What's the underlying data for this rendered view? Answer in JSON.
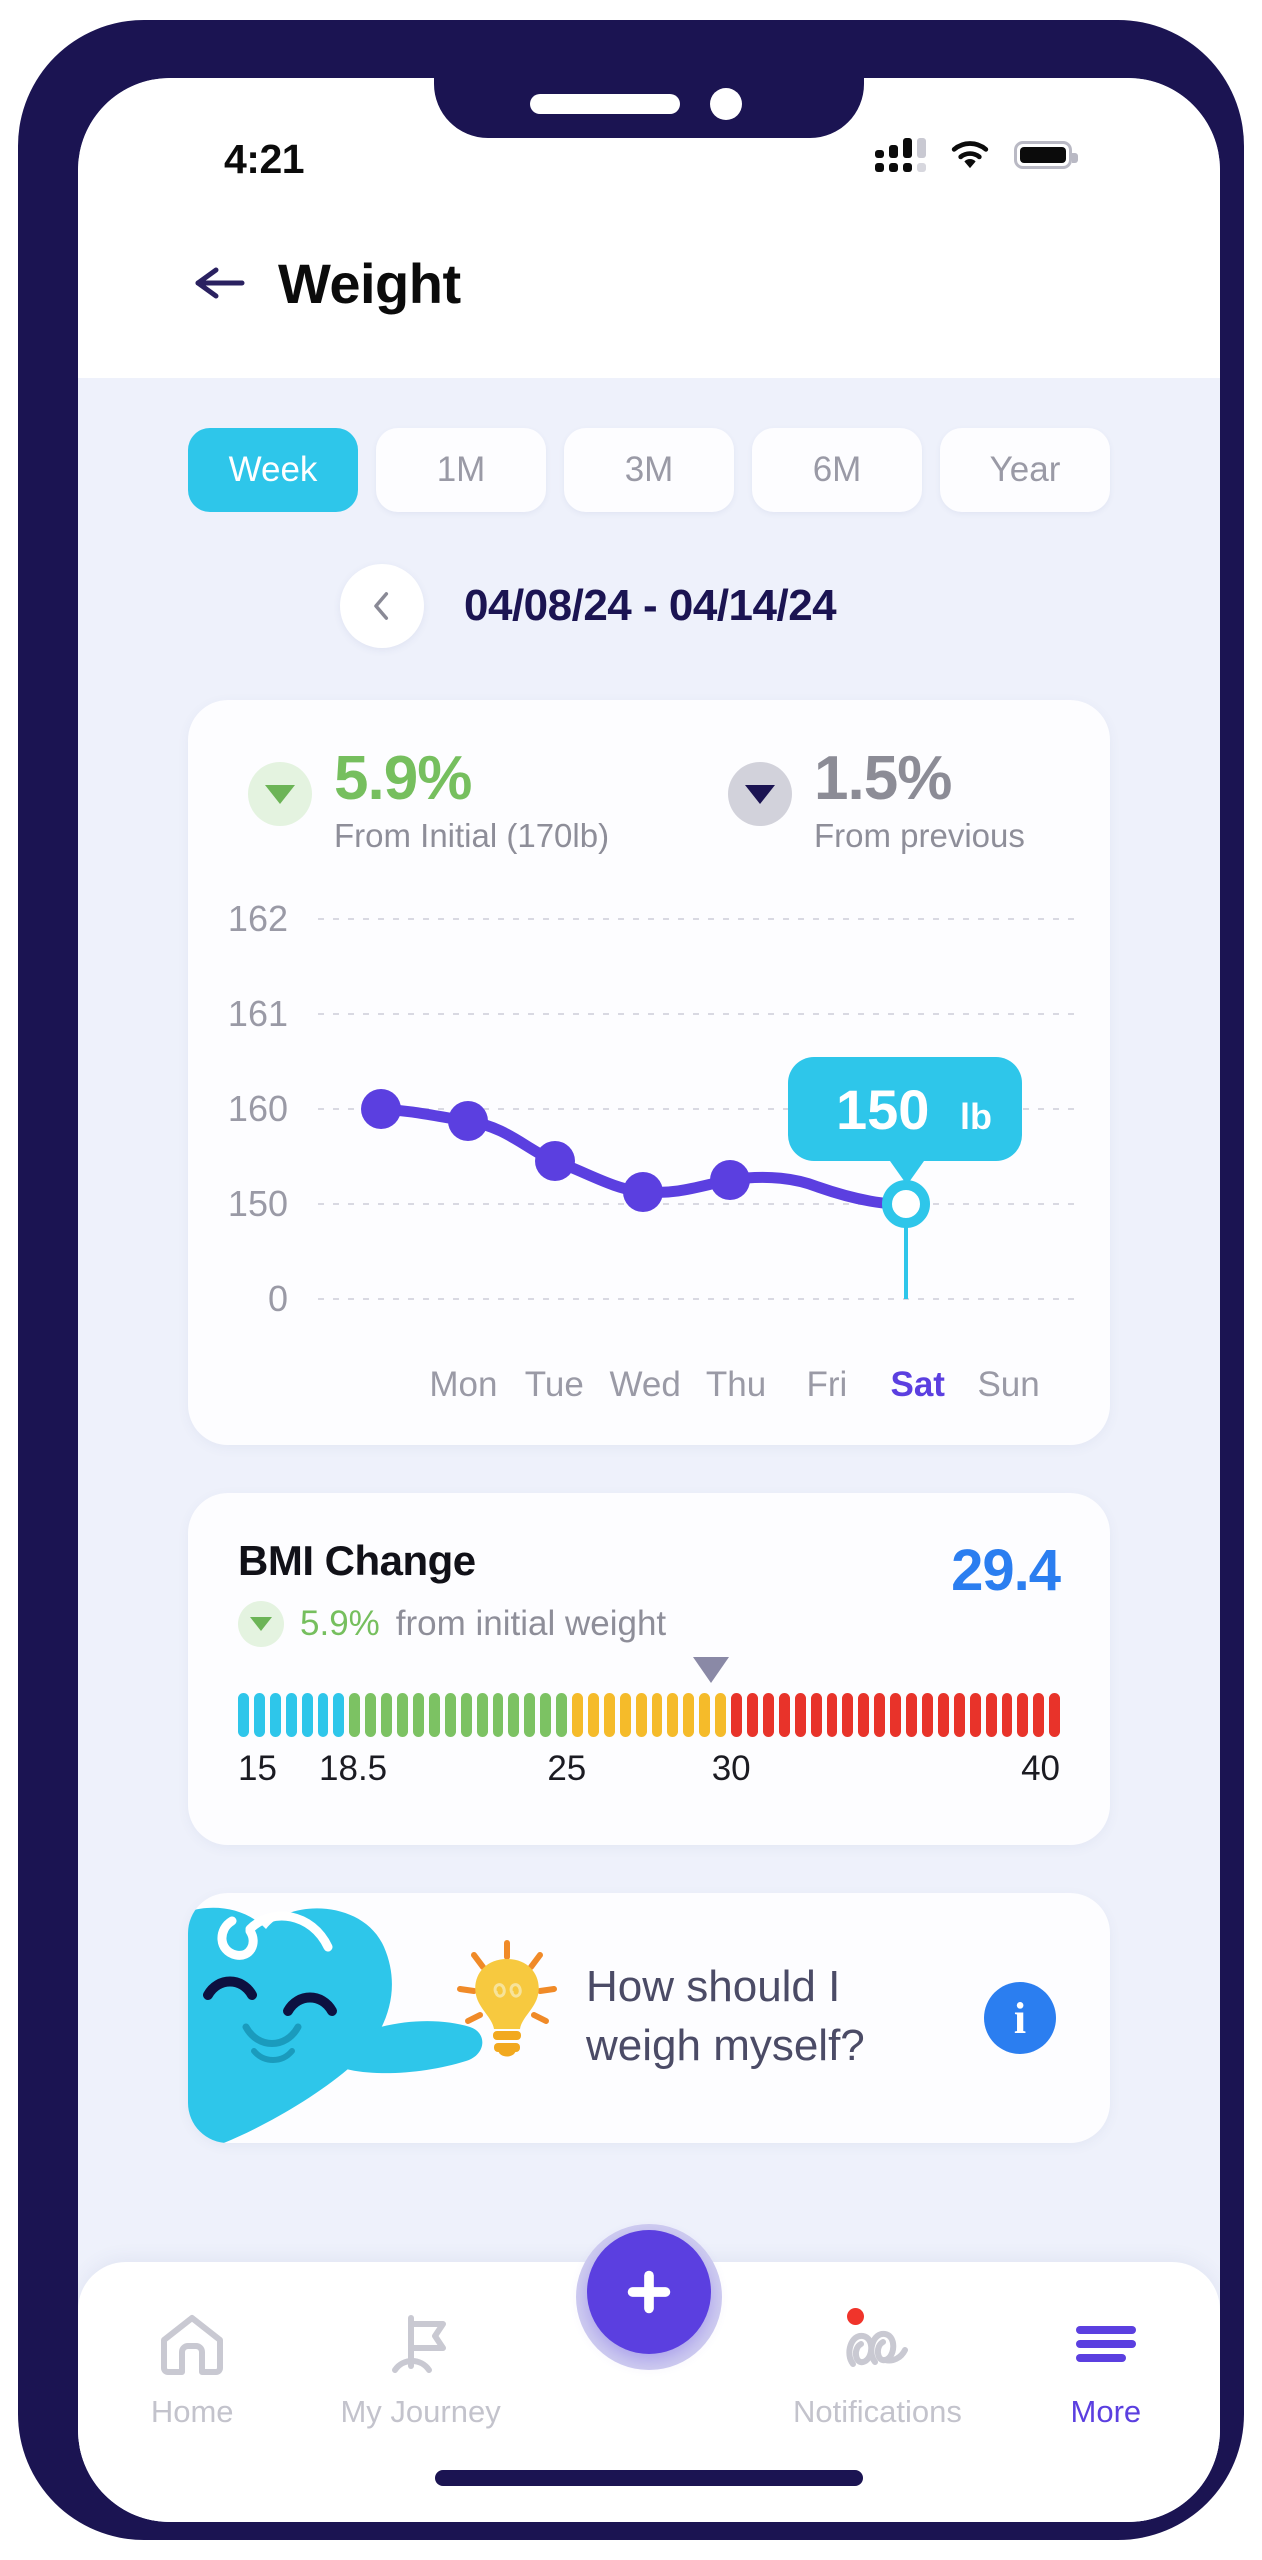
{
  "status_bar": {
    "time": "4:21",
    "icons": [
      "signal-icon",
      "wifi-icon",
      "battery-icon"
    ]
  },
  "header": {
    "back_icon": "back-arrow-icon",
    "title": "Weight"
  },
  "range_tabs": [
    {
      "label": "Week",
      "active": true
    },
    {
      "label": "1M",
      "active": false
    },
    {
      "label": "3M",
      "active": false
    },
    {
      "label": "6M",
      "active": false
    },
    {
      "label": "Year",
      "active": false
    }
  ],
  "date_nav": {
    "prev_icon": "chevron-left-icon",
    "range": "04/08/24 - 04/14/24"
  },
  "stats": {
    "initial": {
      "value": "5.9%",
      "label": "From Initial (170lb)",
      "direction": "down",
      "color": "#76bf5e"
    },
    "previous": {
      "value": "1.5%",
      "label": "From previous",
      "direction": "down",
      "color": "#8c8c96"
    }
  },
  "chart_data": {
    "type": "line",
    "title": "Weight",
    "xlabel": "",
    "ylabel": "lb",
    "categories": [
      "Mon",
      "Tue",
      "Wed",
      "Thu",
      "Fri",
      "Sat",
      "Sun"
    ],
    "values": [
      160,
      159.5,
      155.5,
      153,
      153.8,
      150,
      null
    ],
    "ytick_labels": [
      "162",
      "161",
      "160",
      "150",
      "0"
    ],
    "ytick_values": [
      162,
      161,
      160,
      150,
      0
    ],
    "grid": true,
    "legend": "none",
    "line_color": "#5b3fe0",
    "point_color": "#5b3fe0",
    "selected_index": 5,
    "selected_label": "Sat",
    "selected_color": "#2ec6ea",
    "tooltip": {
      "value": "150",
      "unit": "lb"
    }
  },
  "bmi": {
    "title": "BMI Change",
    "change_pct": "5.9%",
    "change_note": "from initial weight",
    "score": "29.4",
    "score_color": "#2b7ef0",
    "marker_value": 29.4,
    "scale": {
      "min": 15,
      "max": 40,
      "ticks": [
        "15",
        "18.5",
        "25",
        "30",
        "40"
      ],
      "tick_values": [
        15,
        18.5,
        25,
        30,
        40
      ],
      "bands": [
        {
          "to": 18.5,
          "color": "#2ec6ea"
        },
        {
          "to": 25,
          "color": "#7cc263"
        },
        {
          "to": 30,
          "color": "#f5bb2a"
        },
        {
          "to": 40,
          "color": "#e8332a"
        }
      ]
    }
  },
  "tip": {
    "mascot_icon": "mascot-heart-icon",
    "bulb_icon": "lightbulb-icon",
    "line1": "How should I",
    "line2": "weigh myself?",
    "info_label": "i"
  },
  "bottom_nav": [
    {
      "label": "Home",
      "icon": "home-icon",
      "active": false,
      "badge": false
    },
    {
      "label": "My Journey",
      "icon": "flag-icon",
      "active": false,
      "badge": false
    },
    {
      "label": "",
      "icon": "add-icon",
      "active": false,
      "badge": false
    },
    {
      "label": "Notifications",
      "icon": "notifications-icon",
      "active": false,
      "badge": true
    },
    {
      "label": "More",
      "icon": "hamburger-icon",
      "active": true,
      "badge": false
    }
  ]
}
